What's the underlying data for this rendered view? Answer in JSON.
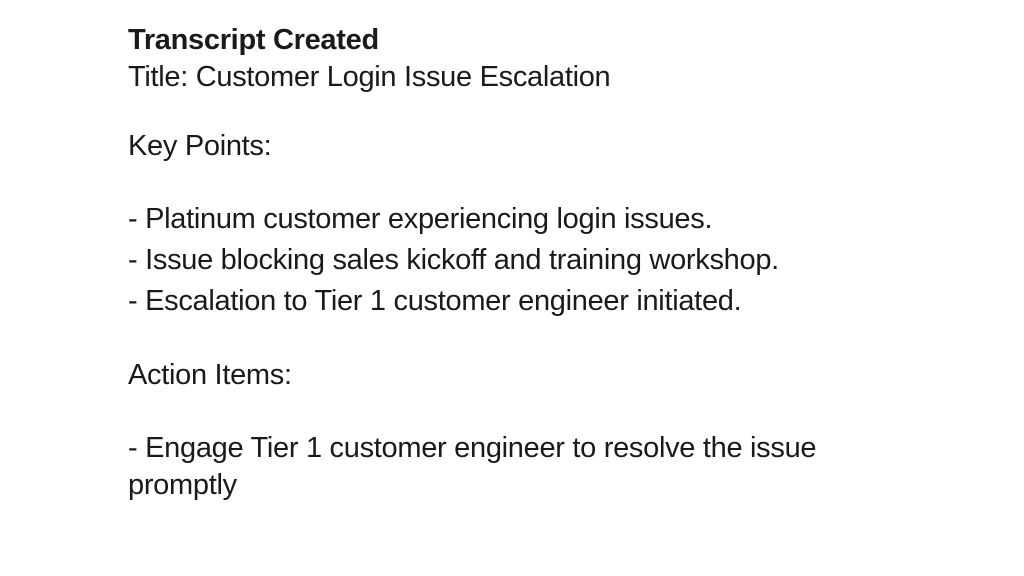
{
  "heading": "Transcript Created",
  "title_prefix": "Title: ",
  "title_value": "Customer Login Issue Escalation",
  "key_points_label": "Key Points:",
  "key_points": [
    "- Platinum customer experiencing login issues.",
    "- Issue blocking sales kickoff and training workshop.",
    "- Escalation to Tier 1 customer engineer initiated."
  ],
  "action_items_label": "Action Items:",
  "action_items": [
    "- Engage Tier 1 customer engineer to resolve the issue"
  ],
  "truncated_fragment": "promptly"
}
